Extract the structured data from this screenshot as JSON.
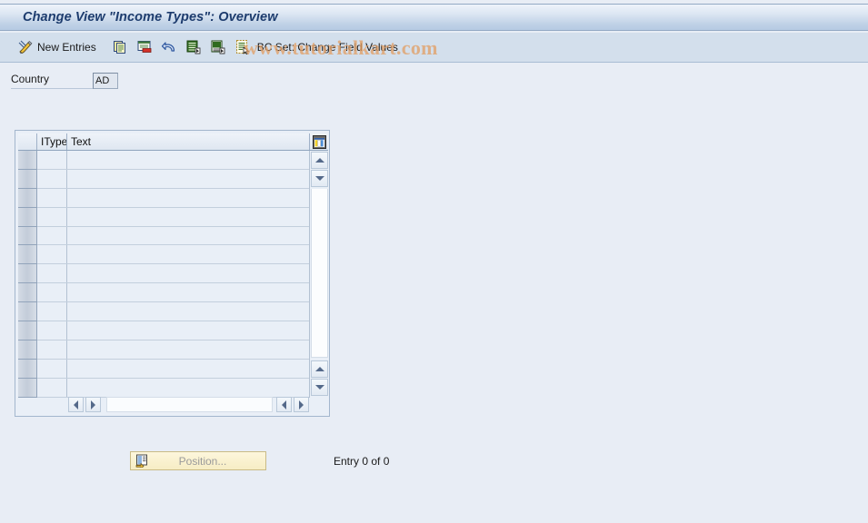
{
  "window": {
    "title": "Change View \"Income Types\": Overview"
  },
  "toolbar": {
    "edit_icon": "pencil-icon",
    "new_entries_label": "New Entries",
    "icons": [
      {
        "name": "copy-icon",
        "title": "Copy As..."
      },
      {
        "name": "delete-icon",
        "title": "Delete"
      },
      {
        "name": "undo-icon",
        "title": "Undo Change"
      },
      {
        "name": "select-all-icon",
        "title": "Select All"
      },
      {
        "name": "deselect-all-icon",
        "title": "Deselect All"
      },
      {
        "name": "details-icon",
        "title": "Details"
      }
    ],
    "bc_set_label": "BC Set: Change Field Values"
  },
  "watermark": {
    "text": "www.tutorialkart.com",
    "color": "#e2a169"
  },
  "selection": {
    "country_label": "Country",
    "country_value": "AD"
  },
  "table": {
    "columns": [
      {
        "key": "select",
        "label": ""
      },
      {
        "key": "ityp",
        "label": "IType"
      },
      {
        "key": "text",
        "label": "Text"
      }
    ],
    "config_icon": "table-settings-icon",
    "rows": [],
    "empty_row_count": 13,
    "vertical_scroll": {
      "up_icon": "scroll-up-icon",
      "down_icon": "scroll-down-icon"
    },
    "horizontal_scroll": {
      "left_icon": "scroll-left-icon",
      "right_icon": "scroll-right-icon"
    }
  },
  "footer": {
    "position_button_label": "Position...",
    "position_button_icon": "position-icon",
    "entry_count_text": "Entry 0 of 0"
  },
  "colors": {
    "page_background": "#e8edf5",
    "titlebar_text": "#1d3c6e",
    "toolbar_background": "#d3dfec",
    "table_cell": "#e9eff7"
  }
}
